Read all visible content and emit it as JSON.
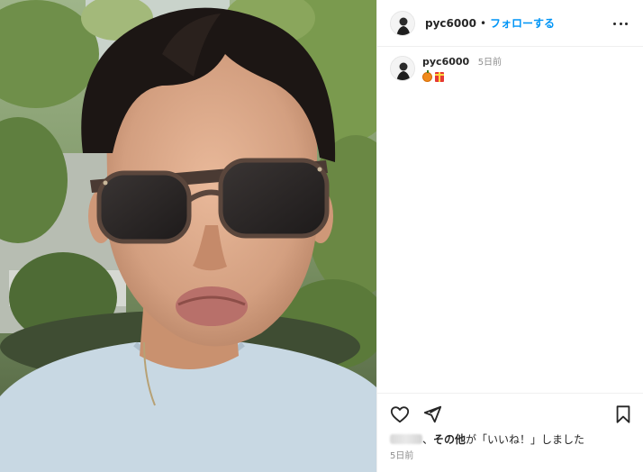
{
  "post": {
    "username": "pyc6000",
    "separator": "•",
    "follow_label": "フォローする",
    "more_icon": "more-horizontal-icon"
  },
  "caption": {
    "username": "pyc6000",
    "time": "5日前",
    "emojis": [
      "pumpkin-emoji",
      "gift-emoji"
    ]
  },
  "actions": {
    "like_icon": "heart-icon",
    "share_icon": "share-icon",
    "save_icon": "bookmark-icon"
  },
  "likes": {
    "separator": "、",
    "others_label": "その他",
    "suffix": "が「いいね！」しました"
  },
  "date": "5日前",
  "colors": {
    "accent": "#0095f6",
    "text": "#262626",
    "muted": "#8e8e8e",
    "divider": "#efefef"
  }
}
